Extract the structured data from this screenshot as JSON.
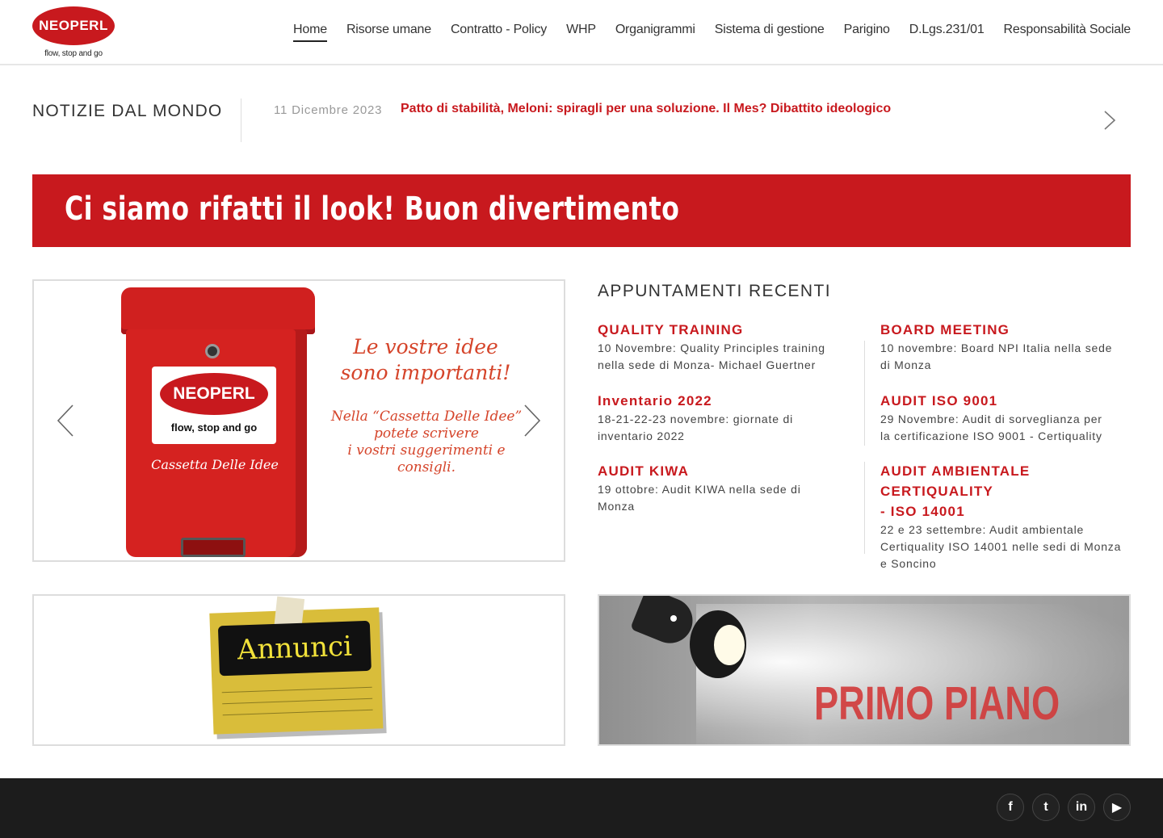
{
  "brand": {
    "logo_text": "NEOPERL",
    "tagline": "flow, stop and go",
    "accent": "#c8191e"
  },
  "nav": [
    {
      "label": "Home",
      "active": true
    },
    {
      "label": "Risorse umane"
    },
    {
      "label": "Contratto - Policy"
    },
    {
      "label": "WHP"
    },
    {
      "label": "Organigrammi"
    },
    {
      "label": "Sistema di gestione"
    },
    {
      "label": "Parigino"
    },
    {
      "label": "D.Lgs.231/01"
    },
    {
      "label": "Responsabilità Sociale"
    }
  ],
  "news": {
    "title": "NOTIZIE DAL MONDO",
    "date": "11 Dicembre 2023",
    "headline": "Patto di stabilità, Meloni: spiragli per una soluzione. Il Mes? Dibattito ideologico"
  },
  "banner": {
    "text": "Ci siamo rifatti il look! Buon divertimento"
  },
  "slider": {
    "mailbox_logo": "NEOPERL",
    "mailbox_tagline": "flow, stop and go",
    "mailbox_name": "Cassetta Delle Idee",
    "headline_1": "Le vostre idee",
    "headline_2": "sono importanti!",
    "sub_1": "Nella “Cassetta Delle Idee”",
    "sub_2": "potete scrivere",
    "sub_3": "i vostri suggerimenti e",
    "sub_4": "consigli."
  },
  "appointments": {
    "title": "APPUNTAMENTI RECENTI",
    "items": [
      {
        "title": "QUALITY TRAINING",
        "desc_1": "10 Novembre: Quality Principles training",
        "desc_2": "nella sede di Monza- Michael Guertner"
      },
      {
        "title": "BOARD MEETING",
        "desc_1": "10 novembre: Board NPI Italia nella sede",
        "desc_2": "di Monza"
      },
      {
        "title": "Inventario 2022",
        "desc_1": "18-21-22-23 novembre: giornate di",
        "desc_2": "inventario 2022"
      },
      {
        "title": "AUDIT ISO 9001",
        "desc_1": "29 Novembre: Audit di sorveglianza per",
        "desc_2": "la certificazione ISO 9001 - Certiquality"
      },
      {
        "title": "AUDIT KIWA",
        "desc_1": "19 ottobre: Audit KIWA nella sede di",
        "desc_2": "Monza"
      },
      {
        "title_1": "AUDIT AMBIENTALE CERTIQUALITY",
        "title_2": "- ISO 14001",
        "desc_1": "22 e 23 settembre: Audit ambientale",
        "desc_2": "Certiquality ISO 14001 nelle sedi di Monza",
        "desc_3": "e Soncino"
      }
    ]
  },
  "boxes": {
    "annunci": "Annunci",
    "primo_piano": "PRIMO PIANO"
  },
  "social": [
    {
      "icon": "facebook-icon",
      "glyph": "f"
    },
    {
      "icon": "twitter-icon",
      "glyph": "t"
    },
    {
      "icon": "linkedin-icon",
      "glyph": "in"
    },
    {
      "icon": "youtube-icon",
      "glyph": "▶"
    }
  ]
}
